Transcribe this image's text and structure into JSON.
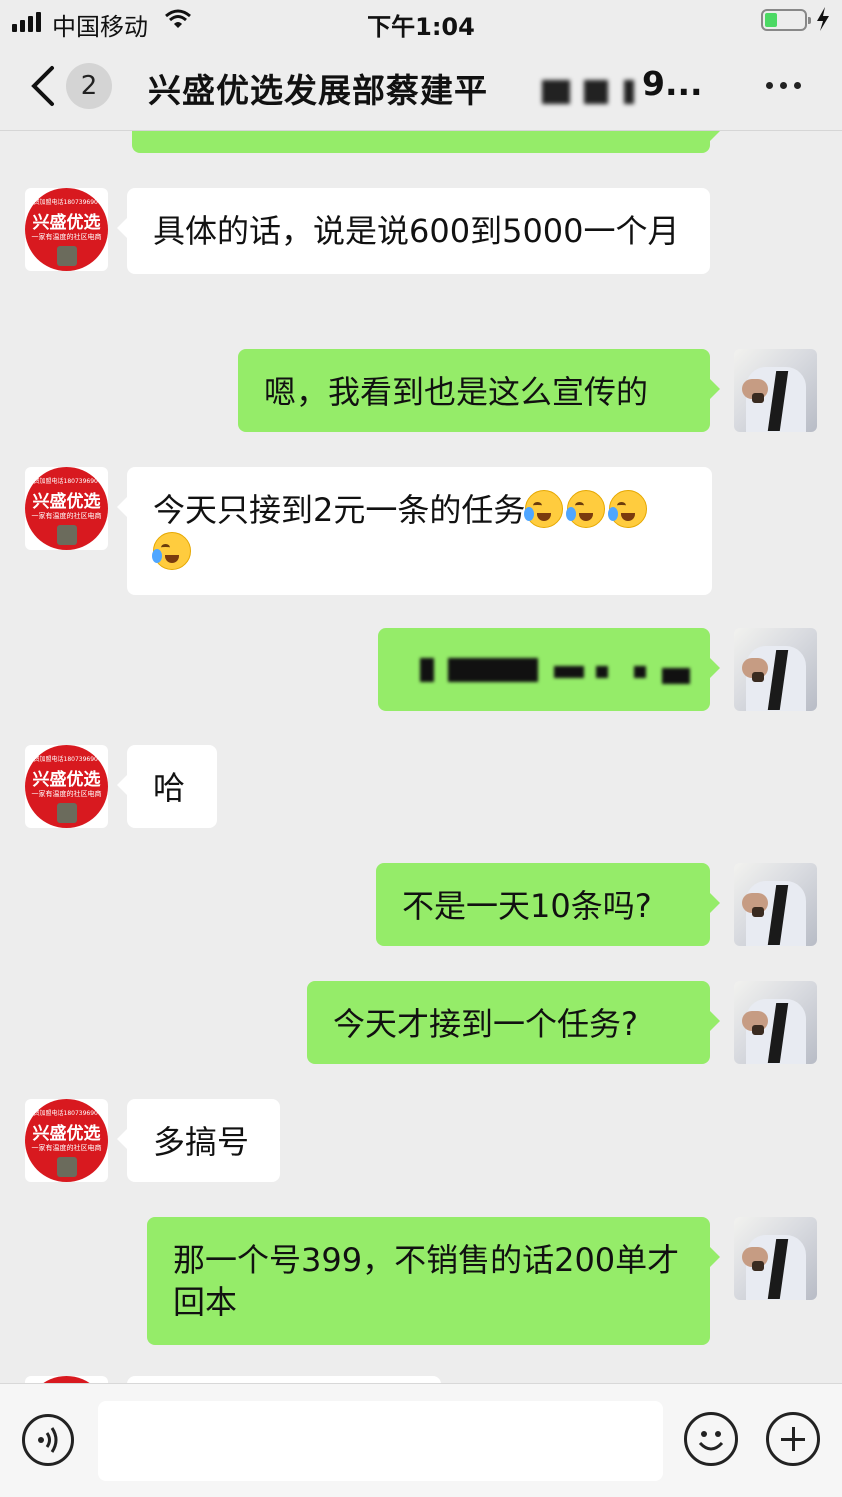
{
  "status_bar": {
    "carrier": "中国移动",
    "time": "下午1:04",
    "battery_level": 0.3,
    "icons": [
      "signal-icon",
      "wifi-icon",
      "battery-icon",
      "charging-icon"
    ]
  },
  "nav": {
    "back_icon": "chevron-left-icon",
    "unread_count": "2",
    "title": "兴盛优选发展部蔡建平",
    "title_tail": "9...",
    "more_icon": "more-dots-icon"
  },
  "contact": {
    "avatar_top_text": "免费加盟电话18073969007",
    "avatar_brand": "兴盛优选",
    "avatar_slogan": "一家有温度的社区电商"
  },
  "messages": [
    {
      "from": "them",
      "text": "具体的话，说是说600到5000一个月"
    },
    {
      "from": "me",
      "text": "嗯，我看到也是这么宣传的"
    },
    {
      "from": "them",
      "text": "今天只接到2元一条的任务",
      "emoji": [
        "crying-laughing-emoji",
        "crying-laughing-emoji",
        "crying-laughing-emoji",
        "crying-laughing-emoji"
      ]
    },
    {
      "from": "me",
      "text": "",
      "redacted": true
    },
    {
      "from": "them",
      "text": "哈"
    },
    {
      "from": "me",
      "text": "不是一天10条吗?"
    },
    {
      "from": "me",
      "text": "今天才接到一个任务?"
    },
    {
      "from": "them",
      "text": "多搞号"
    },
    {
      "from": "me",
      "text": "那一个号399，不销售的话200单才回本"
    }
  ],
  "input_bar": {
    "voice_icon": "voice-icon",
    "text_value": "",
    "emoji_icon": "smiley-icon",
    "plus_icon": "plus-icon"
  },
  "colors": {
    "background": "#ededed",
    "outgoing_bubble": "#95ec69",
    "incoming_bubble": "#ffffff",
    "brand_red": "#d8191f"
  }
}
